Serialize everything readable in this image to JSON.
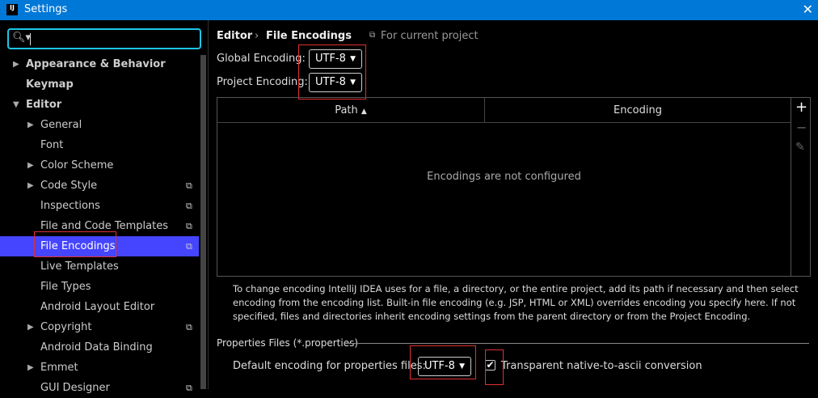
{
  "window": {
    "title": "Settings",
    "close": "✕",
    "logo": "IJ"
  },
  "search": {
    "value": "",
    "icon": "search-icon"
  },
  "tree": [
    {
      "label": "Appearance & Behavior",
      "level": 0,
      "arrow": "▶",
      "bold": true
    },
    {
      "label": "Keymap",
      "level": 0,
      "arrow": "",
      "bold": true
    },
    {
      "label": "Editor",
      "level": 0,
      "arrow": "▼",
      "bold": true
    },
    {
      "label": "General",
      "level": 1,
      "arrow": "▶"
    },
    {
      "label": "Font",
      "level": 1,
      "arrow": ""
    },
    {
      "label": "Color Scheme",
      "level": 1,
      "arrow": "▶"
    },
    {
      "label": "Code Style",
      "level": 1,
      "arrow": "▶",
      "project": true
    },
    {
      "label": "Inspections",
      "level": 1,
      "arrow": "",
      "project": true
    },
    {
      "label": "File and Code Templates",
      "level": 1,
      "arrow": "",
      "project": true
    },
    {
      "label": "File Encodings",
      "level": 1,
      "arrow": "",
      "project": true,
      "selected": true
    },
    {
      "label": "Live Templates",
      "level": 1,
      "arrow": ""
    },
    {
      "label": "File Types",
      "level": 1,
      "arrow": ""
    },
    {
      "label": "Android Layout Editor",
      "level": 1,
      "arrow": ""
    },
    {
      "label": "Copyright",
      "level": 1,
      "arrow": "▶",
      "project": true
    },
    {
      "label": "Android Data Binding",
      "level": 1,
      "arrow": ""
    },
    {
      "label": "Emmet",
      "level": 1,
      "arrow": "▶"
    },
    {
      "label": "GUI Designer",
      "level": 1,
      "arrow": "",
      "project": true
    }
  ],
  "breadcrumb": {
    "parent": "Editor",
    "sep": "›",
    "current": "File Encodings",
    "scope": "For current project"
  },
  "global_encoding": {
    "label": "Global Encoding:",
    "value": "UTF-8"
  },
  "project_encoding": {
    "label": "Project Encoding:",
    "value": "UTF-8"
  },
  "table": {
    "columns": [
      "Path",
      "Encoding"
    ],
    "sort": "▲",
    "empty": "Encodings are not configured",
    "tools": {
      "add": "+",
      "remove": "−",
      "edit": "✎"
    }
  },
  "description": "To change encoding IntelliJ IDEA uses for a file, a directory, or the entire project, add its path if necessary and then select encoding from the encoding list. Built-in file encoding (e.g. JSP, HTML or XML) overrides encoding you specify here. If not specified, files and directories inherit encoding settings from the parent directory or from the Project Encoding.",
  "properties": {
    "section": "Properties Files (*.properties)",
    "label": "Default encoding for properties files:",
    "value": "UTF-8",
    "transparent_label": "Transparent native-to-ascii conversion",
    "transparent_checked": true
  },
  "colors": {
    "titlebar": "#0078d7",
    "selection": "#4545ff",
    "search_focus": "#1cc6e8",
    "highlight": "#e03030"
  }
}
